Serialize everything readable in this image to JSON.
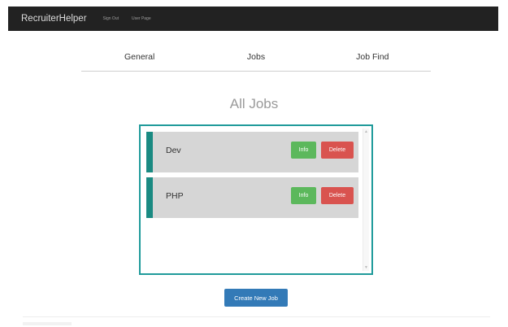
{
  "navbar": {
    "brand": "RecruiterHelper",
    "links": [
      "Sign Out",
      "User Page"
    ]
  },
  "tabs": [
    "General",
    "Jobs",
    "Job Find"
  ],
  "main": {
    "title": "All Jobs",
    "jobs": [
      {
        "name": "Dev",
        "info_label": "Info",
        "delete_label": "Delete"
      },
      {
        "name": "PHP",
        "info_label": "Info",
        "delete_label": "Delete"
      }
    ],
    "create_label": "Create New Job"
  },
  "colors": {
    "navbar": "#222222",
    "panel_border": "#1f9a9a",
    "card_accent": "#1a8a82",
    "info": "#5cb85c",
    "delete": "#d9534f",
    "primary": "#337ab7"
  },
  "icons": {
    "scroll_up": "▲",
    "scroll_down": "▼"
  }
}
